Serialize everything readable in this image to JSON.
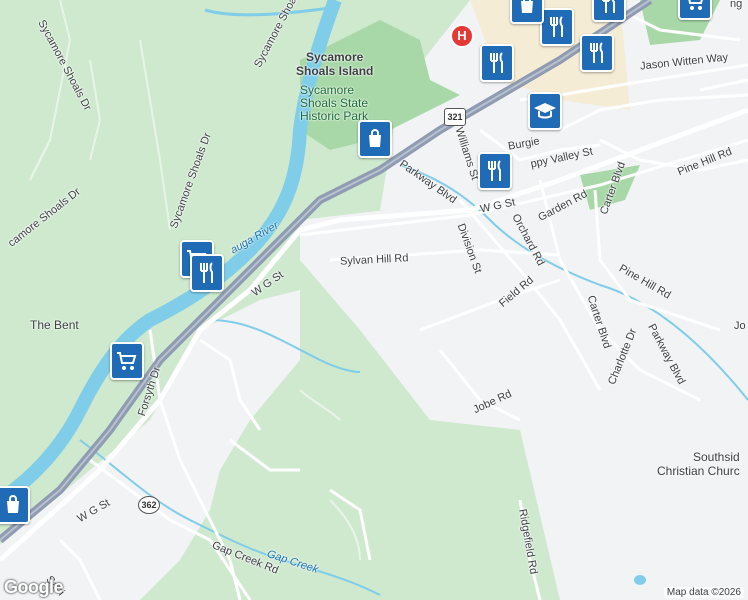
{
  "map": {
    "places": {
      "island": "Sycamore\nShoals Island",
      "park": "Sycamore\nShoals State\nHistoric Park",
      "bent": "The Bent",
      "church": "Southsid\nChristian Churc"
    },
    "waters": {
      "river": "auga River",
      "creek": "Gap Creek"
    },
    "roads": {
      "sycamore_shoals_dr_1": "Sycamore Shoals Dr",
      "sycamore_shoals_dr_2": "Sycamore Shoals Dr",
      "sycamore_shoals_dr_3": "Sycamore Shoals Dr",
      "sycamore_shoals_dr_4": "camore Shoals Dr",
      "sycamore_shoals_dr_5": "Sycamore Shoals Dr",
      "wgst_1": "W G St",
      "wgst_2": "W G St",
      "wgst_3": "W G St",
      "sylvan": "Sylvan Hill Rd",
      "parkway_1": "Parkway Blvd",
      "parkway_2": "Parkway Blvd",
      "williams": "Williams St",
      "burgie": "Burgie",
      "happy": "ppy Valley St",
      "division": "Division St",
      "field": "Field Rd",
      "garden": "Garden Rd",
      "orchard": "Orchard Rd",
      "carter_1": "Carter Blvd",
      "carter_2": "Carter Blvd",
      "pine_1": "Pine Hill Rd",
      "pine_2": "Pine Hill Rd",
      "charlotte": "Charlotte Dr",
      "jobe": "Jobe Rd",
      "jo": "Jo",
      "forsyth": "Forsyth Dr",
      "ridgefield": "Ridgefield Rd",
      "gapcreek": "Gap Creek Rd",
      "sabi": "Sabi",
      "jason": "Jason Witten Way",
      "ng": "ng"
    },
    "shields": {
      "us321": "321",
      "sr362": "362"
    },
    "attribution": "Map data ©2026",
    "logo": "Google"
  },
  "pois": [
    {
      "name": "poi-shopping-bag-island",
      "icon": "shopping-bag-icon"
    },
    {
      "name": "poi-restaurant-top-1",
      "icon": "restaurant-icon"
    },
    {
      "name": "poi-education",
      "icon": "graduation-cap-icon"
    },
    {
      "name": "poi-restaurant-mid",
      "icon": "restaurant-icon"
    },
    {
      "name": "poi-grocery-cart-1",
      "icon": "shopping-cart-icon"
    },
    {
      "name": "poi-restaurant-left",
      "icon": "restaurant-icon"
    },
    {
      "name": "poi-grocery-cart-2",
      "icon": "shopping-cart-icon"
    },
    {
      "name": "poi-shopping-bag-bottom",
      "icon": "shopping-bag-icon"
    }
  ],
  "colors": {
    "forest": "#cfe9cf",
    "park": "#a8d8a8",
    "urban": "#f1f3f4",
    "river": "#7fcde8",
    "highway": "#8e9bb0",
    "poi": "#1f6bb5",
    "hospital": "#e53935"
  }
}
